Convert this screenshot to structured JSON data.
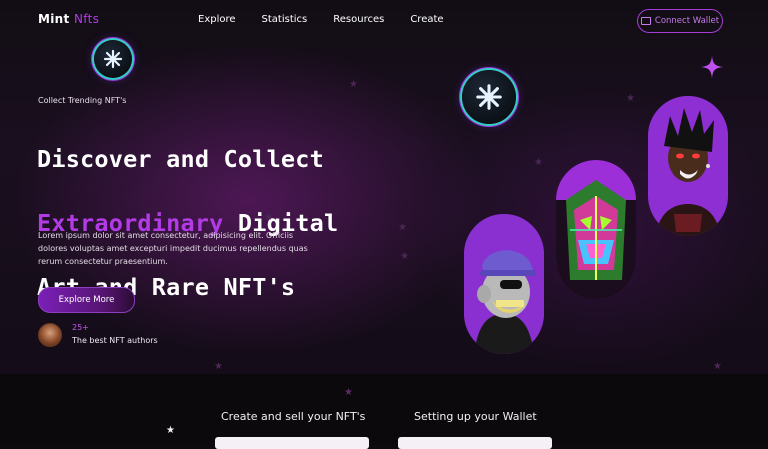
{
  "brand": {
    "name": "Mint",
    "accent": "Nfts",
    "accent_color": "#b23be6"
  },
  "nav": {
    "items": [
      "Explore",
      "Statistics",
      "Resources",
      "Create"
    ],
    "wallet_label": "Connect Wallet"
  },
  "hero": {
    "eyebrow": "Collect Trending NFT's",
    "headline_line1": "Discover and Collect",
    "headline_highlight": "Extraordinary",
    "headline_line2_rest": " Digital",
    "headline_line3": "Art and Rare NFT's",
    "description": "Lorem ipsum dolor sit amet consectetur, adipisicing elit. Officiis dolores voluptas amet excepturi impedit ducimus repellendus quas rerum consectetur praesentium.",
    "cta_label": "Explore More",
    "authors_count": "25+",
    "authors_label": "The best NFT authors"
  },
  "steps": {
    "items": [
      "Create and sell your NFT's",
      "Setting up your Wallet"
    ]
  },
  "icons": [
    "wallet-icon",
    "badge-logo-icon",
    "sparkle-icon",
    "star-icon"
  ]
}
